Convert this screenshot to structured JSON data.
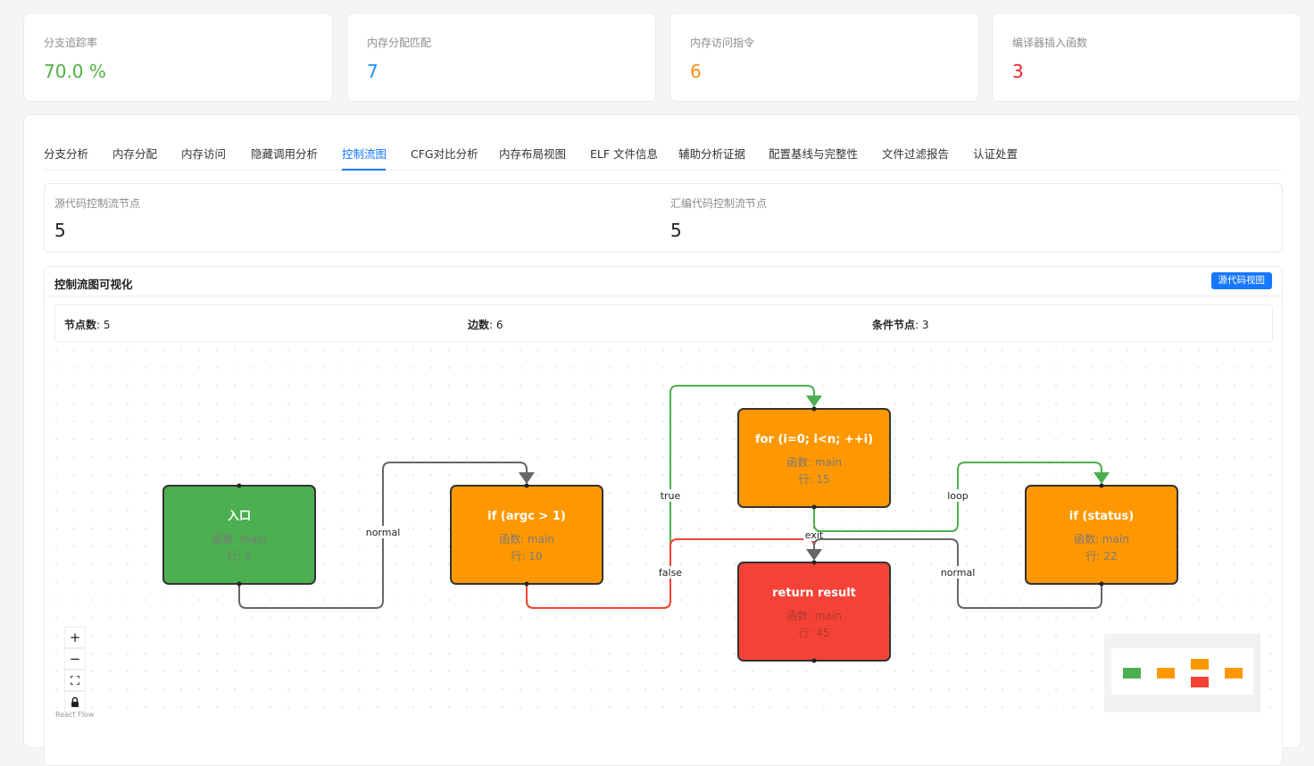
{
  "stats": [
    {
      "label": "分支追踪率",
      "value": "70.0 %",
      "color": "#52b043"
    },
    {
      "label": "内存分配匹配",
      "value": "7",
      "color": "#1890ff"
    },
    {
      "label": "内存访问指令",
      "value": "6",
      "color": "#fa8c16"
    },
    {
      "label": "编译器插入函数",
      "value": "3",
      "color": "#f5222d"
    }
  ],
  "tabs": [
    "分支分析",
    "内存分配",
    "内存访问",
    "隐藏调用分析",
    "控制流图",
    "CFG对比分析",
    "内存布局视图",
    "ELF 文件信息",
    "辅助分析证据",
    "配置基线与完整性",
    "文件过滤报告",
    "认证处置"
  ],
  "active_tab": "控制流图",
  "cfg_counts": {
    "source_label": "源代码控制流节点",
    "source_value": "5",
    "asm_label": "汇编代码控制流节点",
    "asm_value": "5"
  },
  "panel": {
    "title": "控制流图可视化",
    "view_button": "源代码视图",
    "node_count_label": "节点数",
    "node_count": ": 5",
    "edge_count_label": "边数",
    "edge_count": ": 6",
    "cond_count_label": "条件节点",
    "cond_count": ": 3"
  },
  "nodes": [
    {
      "id": "entry",
      "title": "入口",
      "func": "函数: main",
      "line": "行: 5",
      "color": "#4caf50"
    },
    {
      "id": "if_argc",
      "title": "if (argc > 1)",
      "func": "函数: main",
      "line": "行: 10",
      "color": "#ff9800"
    },
    {
      "id": "for_loop",
      "title": "for (i=0; i<n; ++i)",
      "func": "函数: main",
      "line": "行: 15",
      "color": "#ff9800"
    },
    {
      "id": "if_status",
      "title": "if (status)",
      "func": "函数: main",
      "line": "行: 22",
      "color": "#ff9800"
    },
    {
      "id": "return",
      "title": "return result",
      "func": "函数: main",
      "line": "行: 45",
      "color": "#f44336"
    }
  ],
  "edges": [
    {
      "from": "entry",
      "to": "if_argc",
      "label": "normal",
      "color": "#666666"
    },
    {
      "from": "if_argc",
      "to": "for_loop",
      "label": "true",
      "color": "#4caf50"
    },
    {
      "from": "if_argc",
      "to": "return",
      "label": "false",
      "color": "#f44336"
    },
    {
      "from": "for_loop",
      "to": "return",
      "label": "exit",
      "color": "#f44336"
    },
    {
      "from": "for_loop",
      "to": "if_status",
      "label": "loop",
      "color": "#4caf50"
    },
    {
      "from": "if_status",
      "to": "return",
      "label": "normal",
      "color": "#666666"
    }
  ],
  "controls": {
    "zoom_in": "+",
    "zoom_out": "−",
    "attribution": "React Flow"
  },
  "icons": [
    "plus-icon",
    "minus-icon",
    "fit-view-icon",
    "lock-icon"
  ]
}
